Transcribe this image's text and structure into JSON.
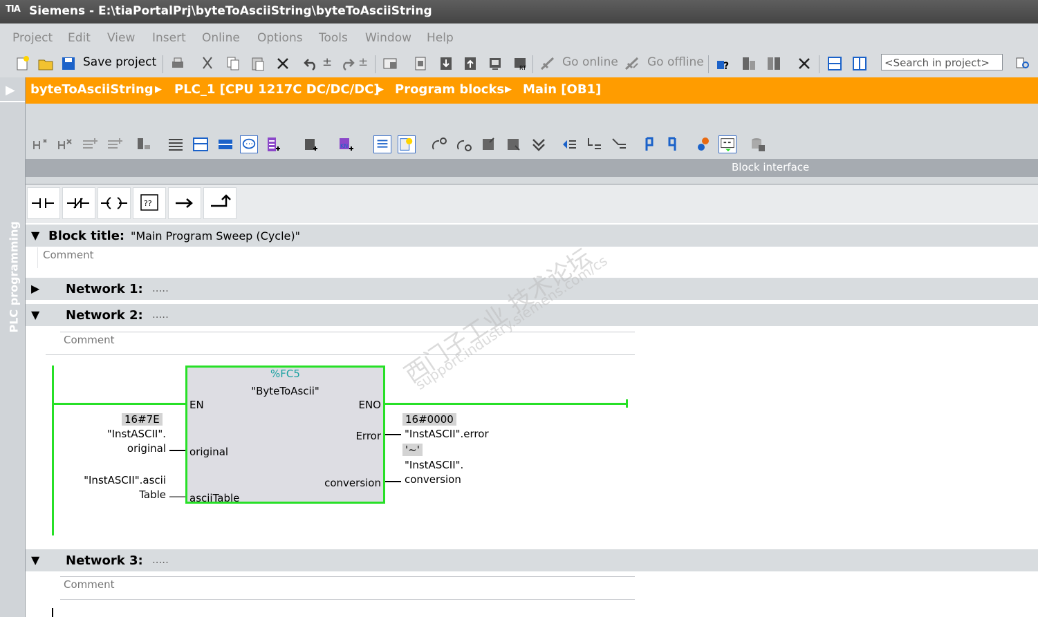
{
  "window": {
    "title": "Siemens - E:\\tiaPortalPrj\\byteToAsciiString\\byteToAsciiString",
    "logo": "TIA"
  },
  "menu": [
    "Project",
    "Edit",
    "View",
    "Insert",
    "Online",
    "Options",
    "Tools",
    "Window",
    "Help"
  ],
  "toolbar": {
    "save_label": "Save project",
    "go_online": "Go online",
    "go_offline": "Go offline"
  },
  "search": {
    "placeholder": "<Search in project>"
  },
  "side_panel": {
    "label": "PLC programming"
  },
  "breadcrumb": [
    "byteToAsciiString",
    "PLC_1 [CPU 1217C DC/DC/DC]",
    "Program blocks",
    "Main [OB1]"
  ],
  "block_interface": "Block interface",
  "block": {
    "title_label": "Block title:",
    "title_value": "\"Main Program Sweep (Cycle)\"",
    "comment": "Comment"
  },
  "networks": [
    {
      "label": "Network 1:",
      "dots": ".....",
      "expanded": false
    },
    {
      "label": "Network 2:",
      "dots": ".....",
      "expanded": true,
      "comment": "Comment"
    },
    {
      "label": "Network 3:",
      "dots": ".....",
      "expanded": true,
      "comment": "Comment"
    }
  ],
  "fc": {
    "address": "%FC5",
    "name": "\"ByteToAscii\"",
    "en": "EN",
    "eno": "ENO",
    "in1": "original",
    "in2": "asciiTable",
    "out1": "Error",
    "out2": "conversion",
    "in1_value": "16#7E",
    "in1_tag_line1": "\"InstASCII\".",
    "in1_tag_line2": "original",
    "in2_tag_line1": "\"InstASCII\".ascii",
    "in2_tag_line2": "Table",
    "out1_value": "16#0000",
    "out1_tag": "\"InstASCII\".error",
    "out2_value": "'~'",
    "out2_tag_line1": "\"InstASCII\".",
    "out2_tag_line2": "conversion"
  },
  "watermark": {
    "line1": "西门子工业  技术论坛",
    "line2": "support.industry.siemens.com/cs"
  }
}
